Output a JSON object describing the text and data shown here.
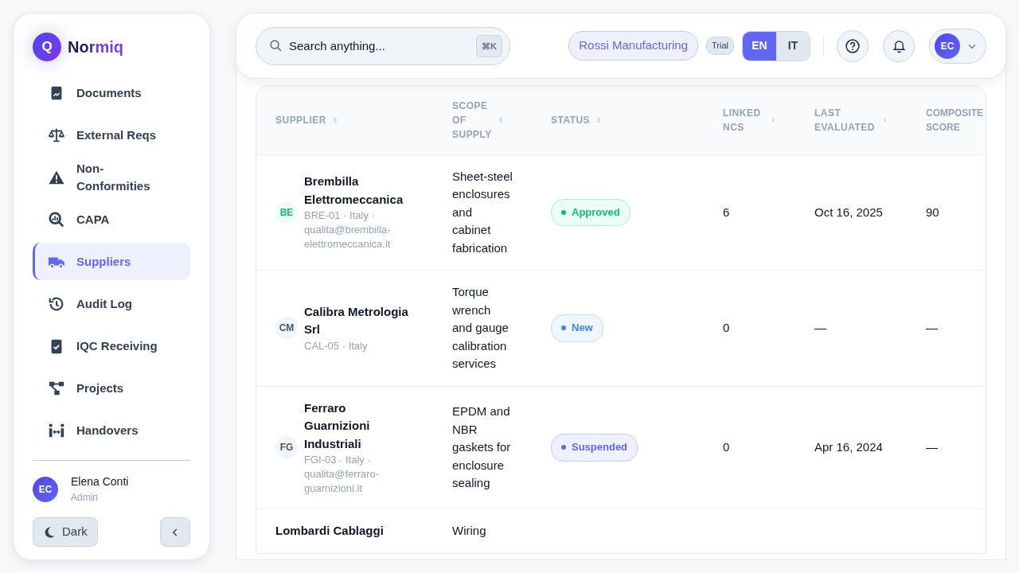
{
  "brand": {
    "mark": "Q",
    "name": "Normiq"
  },
  "nav": [
    {
      "label": "Documents",
      "selected": false
    },
    {
      "label": "External Reqs",
      "selected": false
    },
    {
      "label": "Non-Conformities",
      "selected": false
    },
    {
      "label": "CAPA",
      "selected": false
    },
    {
      "label": "Suppliers",
      "selected": true
    },
    {
      "label": "Audit Log",
      "selected": false
    },
    {
      "label": "IQC Receiving",
      "selected": false
    },
    {
      "label": "Projects",
      "selected": false
    },
    {
      "label": "Handovers",
      "selected": false
    }
  ],
  "user": {
    "initials": "EC",
    "name": "Elena Conti",
    "role": "Admin"
  },
  "theme_button": "Dark",
  "search": {
    "placeholder": "Search anything...",
    "shortcut": "⌘K"
  },
  "organization": "Rossi Manufacturing",
  "plan": "Trial",
  "languages": [
    {
      "label": "EN",
      "selected": true
    },
    {
      "label": "IT",
      "selected": false
    }
  ],
  "account": {
    "initials": "EC"
  },
  "table": {
    "columns": [
      "SUPPLIER",
      "SCOPE OF SUPPLY",
      "STATUS",
      "LINKED NCS",
      "LAST EVALUATED",
      "COMPOSITE SCORE"
    ],
    "rows": [
      {
        "initials": "BE",
        "color": "#10b981",
        "name": "Brembilla Elettromeccanica",
        "details": "BRE-01 · Italy · qualita@brembilla-elettromeccanica.it",
        "scope": "Sheet-steel enclosures and cabinet fabrication",
        "status": {
          "label": "Approved",
          "kind": "approved"
        },
        "linked_ncs": "6",
        "last_evaluated": "Oct 16, 2025",
        "score": "90"
      },
      {
        "initials": "CM",
        "color": "#475569",
        "name": "Calibra Metrologia Srl",
        "details": "CAL-05 · Italy",
        "scope": "Torque wrench and gauge calibration services",
        "status": {
          "label": "New",
          "kind": "new"
        },
        "linked_ncs": "0",
        "last_evaluated": "—",
        "score": "—"
      },
      {
        "initials": "FG",
        "color": "#475569",
        "name": "Ferraro Guarnizioni Industriali",
        "details": "FGI-03 · Italy · qualita@ferraro-guarnizioni.it",
        "scope": "EPDM and NBR gaskets for enclosure sealing",
        "status": {
          "label": "Suspended",
          "kind": "suspended"
        },
        "linked_ncs": "0",
        "last_evaluated": "Apr 16, 2024",
        "score": "—"
      },
      {
        "name": "Lombardi Cablaggi",
        "scope": "Wiring"
      }
    ]
  }
}
